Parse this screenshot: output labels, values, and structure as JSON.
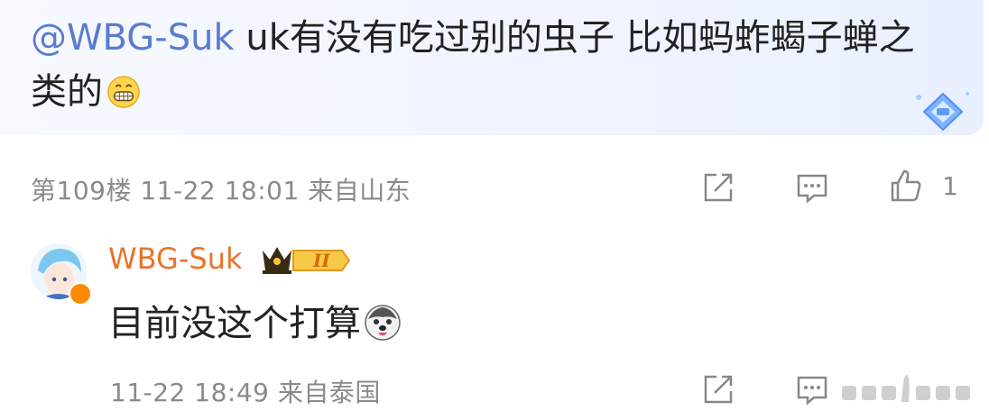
{
  "post": {
    "mention": "@WBG-Suk",
    "text": " uk有没有吃过别的虫子 比如蚂蚱蝎子蝉之类的",
    "emoji": "grin-emoji"
  },
  "post_meta": {
    "floor": "第109楼",
    "time": "11-22 18:01",
    "location": "来自山东",
    "like_count": "1"
  },
  "reply": {
    "author": "WBG-Suk",
    "badge_level": "II",
    "text": "目前没这个打算",
    "emoji": "husky-emoji",
    "time": "11-22 18:49",
    "location": "来自泰国"
  },
  "icons": [
    "share-icon",
    "comment-icon",
    "like-icon",
    "crown-icon",
    "verified-icon"
  ],
  "colors": {
    "mention": "#5a7bd1",
    "author": "#e8742a",
    "meta": "#8a8a8a",
    "bubble": "#eef3ff"
  }
}
